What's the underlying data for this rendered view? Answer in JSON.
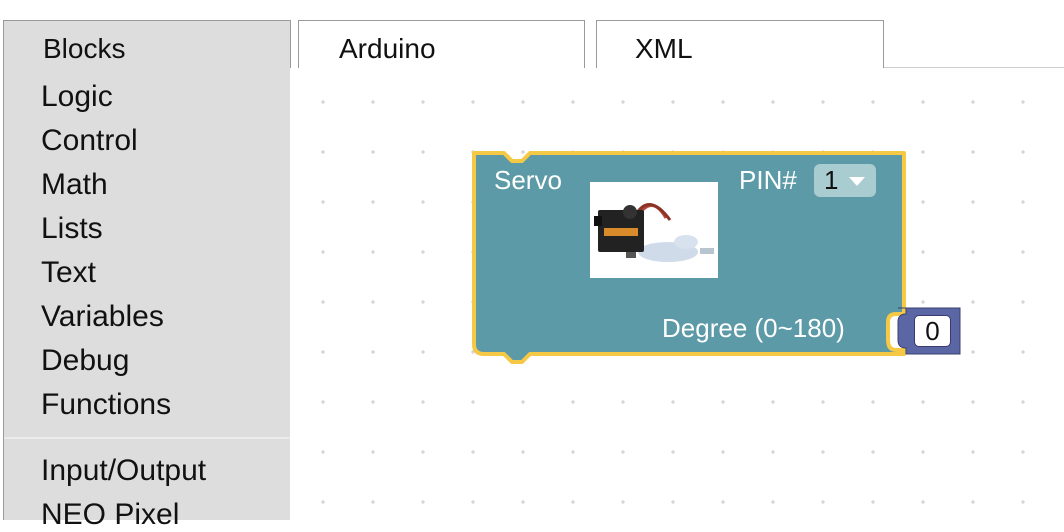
{
  "tabs": [
    {
      "label": "Blocks"
    },
    {
      "label": "Arduino"
    },
    {
      "label": "XML"
    }
  ],
  "sidebar": {
    "items": [
      {
        "label": "Logic"
      },
      {
        "label": "Control"
      },
      {
        "label": "Math"
      },
      {
        "label": "Lists"
      },
      {
        "label": "Text"
      },
      {
        "label": "Variables"
      },
      {
        "label": "Debug"
      },
      {
        "label": "Functions"
      },
      {
        "label": "Input/Output"
      },
      {
        "label": "NEO Pixel"
      }
    ]
  },
  "servo_block": {
    "title": "Servo",
    "pin_label": "PIN#",
    "pin_value": "1",
    "degree_label": "Degree (0~180)",
    "degree_value": "0",
    "color": "#5b9aa6",
    "outline_color": "#f5c945"
  },
  "number_block": {
    "color": "#5b67a5"
  }
}
